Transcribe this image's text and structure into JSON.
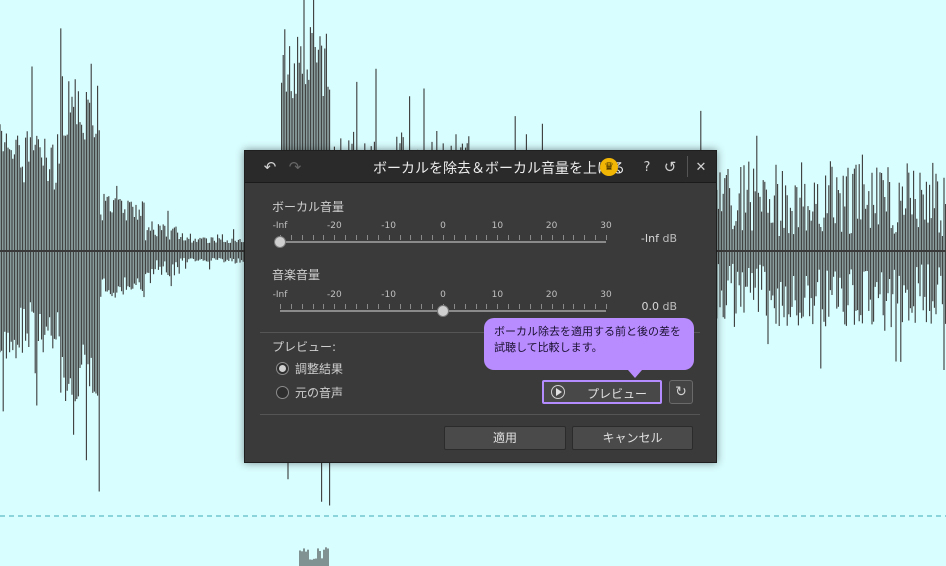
{
  "dialog": {
    "title": "ボーカルを除去＆ボーカル音量を上げる",
    "icons": {
      "undo": "undo-arrow-icon",
      "redo": "redo-arrow-icon",
      "premium": "crown-icon",
      "help": "help-icon",
      "reset": "reset-icon",
      "close": "close-icon"
    },
    "help_glyph": "?",
    "close_glyph": "✕",
    "crown_glyph": "♛"
  },
  "vocal_volume": {
    "label": "ボーカル音量",
    "ticks": [
      "-Inf",
      "-20",
      "-10",
      "0",
      "10",
      "20",
      "30"
    ],
    "value_text": "-Inf",
    "unit": "dB",
    "thumb_fraction": 0.0
  },
  "music_volume": {
    "label": "音楽音量",
    "ticks": [
      "-Inf",
      "-20",
      "-10",
      "0",
      "10",
      "20",
      "30"
    ],
    "value_text": "0.0",
    "unit": "dB",
    "thumb_fraction": 0.5
  },
  "preview": {
    "section_label": "プレビュー:",
    "options": [
      {
        "label": "調整結果",
        "selected": true
      },
      {
        "label": "元の音声",
        "selected": false
      }
    ],
    "tooltip": "ボーカル除去を適用する前と後の差を試聴して比較します。",
    "button_label": "プレビュー",
    "accent": "#b48cff"
  },
  "footer": {
    "apply_label": "適用",
    "cancel_label": "キャンセル"
  },
  "colors": {
    "background": "#d9feff",
    "waveform": "#3a3a3a",
    "dialog": "#3a3a3a",
    "tooltip": "#b88cff"
  }
}
